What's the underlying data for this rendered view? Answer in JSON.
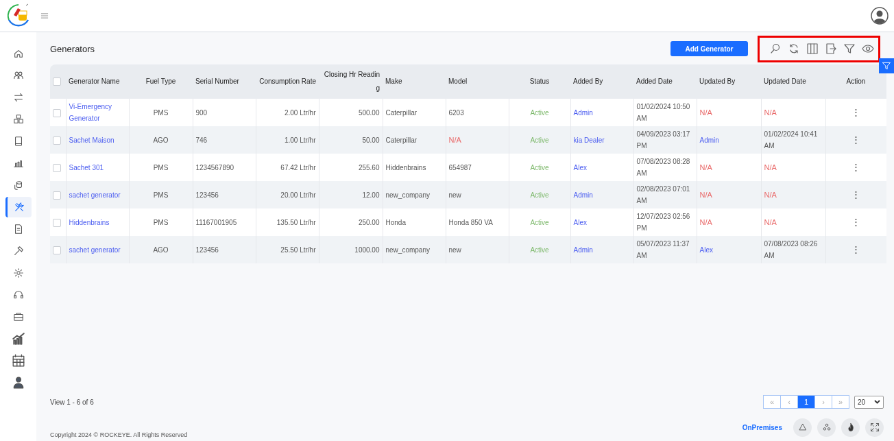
{
  "sidebar": {
    "items": [
      {
        "selected": false
      },
      {
        "selected": false
      },
      {
        "selected": false
      },
      {
        "selected": false
      },
      {
        "selected": false
      },
      {
        "selected": false
      },
      {
        "selected": false
      },
      {
        "selected": true
      },
      {
        "selected": false
      },
      {
        "selected": false
      },
      {
        "selected": false
      },
      {
        "selected": false
      },
      {
        "selected": false
      },
      {
        "selected": false
      },
      {
        "selected": false
      },
      {
        "selected": false
      }
    ]
  },
  "page": {
    "title": "Generators",
    "add_button": "Add Generator"
  },
  "toolbar": {
    "highlighted": true
  },
  "table": {
    "select_all_checked": false,
    "columns": [
      "Generator Name",
      "Fuel Type",
      "Serial Number",
      "Consumption Rate",
      "Closing Hr Reading",
      "Make",
      "Model",
      "Status",
      "Added By",
      "Added Date",
      "Updated By",
      "Updated Date",
      "Action"
    ],
    "rows": [
      {
        "checked": false,
        "name": "Vi-Emergency Generator",
        "fuel_type": "PMS",
        "serial": "900",
        "rate": "2.00 Ltr/hr",
        "closing": "500.00",
        "make": "Caterpillar",
        "model": {
          "text": "6203",
          "kind": "plain"
        },
        "status": "Active",
        "added_by": "Admin",
        "added_date": "01/02/2024 10:50 AM",
        "updated_by": {
          "text": "N/A",
          "kind": "missing"
        },
        "updated_date": {
          "text": "N/A",
          "kind": "missing"
        },
        "action": "⋮"
      },
      {
        "checked": false,
        "name": "Sachet Maison",
        "fuel_type": "AGO",
        "serial": "746",
        "rate": "1.00 Ltr/hr",
        "closing": "50.00",
        "make": "Caterpillar",
        "model": {
          "text": "N/A",
          "kind": "missing"
        },
        "status": "Active",
        "added_by": "kia Dealer",
        "added_date": "04/09/2023 03:17 PM",
        "updated_by": {
          "text": "Admin",
          "kind": "link"
        },
        "updated_date": {
          "text": "01/02/2024 10:41 AM",
          "kind": "plain"
        },
        "action": "⋮"
      },
      {
        "checked": false,
        "name": "Sachet 301",
        "fuel_type": "PMS",
        "serial": "1234567890",
        "rate": "67.42 Ltr/hr",
        "closing": "255.60",
        "make": "Hiddenbrains",
        "model": {
          "text": "654987",
          "kind": "plain"
        },
        "status": "Active",
        "added_by": "Alex",
        "added_date": "07/08/2023 08:28 AM",
        "updated_by": {
          "text": "N/A",
          "kind": "missing"
        },
        "updated_date": {
          "text": "N/A",
          "kind": "missing"
        },
        "action": "⋮"
      },
      {
        "checked": false,
        "name": "sachet generator",
        "fuel_type": "PMS",
        "serial": "123456",
        "rate": "20.00 Ltr/hr",
        "closing": "12.00",
        "make": "new_company",
        "model": {
          "text": "new",
          "kind": "plain"
        },
        "status": "Active",
        "added_by": "Admin",
        "added_date": "02/08/2023 07:01 AM",
        "updated_by": {
          "text": "N/A",
          "kind": "missing"
        },
        "updated_date": {
          "text": "N/A",
          "kind": "missing"
        },
        "action": "⋮"
      },
      {
        "checked": false,
        "name": "Hiddenbrains",
        "fuel_type": "PMS",
        "serial": "11167001905",
        "rate": "135.50 Ltr/hr",
        "closing": "250.00",
        "make": "Honda",
        "model": {
          "text": "Honda 850 VA",
          "kind": "plain"
        },
        "status": "Active",
        "added_by": "Alex",
        "added_date": "12/07/2023 02:56 PM",
        "updated_by": {
          "text": "N/A",
          "kind": "missing"
        },
        "updated_date": {
          "text": "N/A",
          "kind": "missing"
        },
        "action": "⋮"
      },
      {
        "checked": false,
        "name": "sachet generator",
        "fuel_type": "AGO",
        "serial": "123456",
        "rate": "25.50 Ltr/hr",
        "closing": "1000.00",
        "make": "new_company",
        "model": {
          "text": "new",
          "kind": "plain"
        },
        "status": "Active",
        "added_by": "Admin",
        "added_date": "05/07/2023 11:37 AM",
        "updated_by": {
          "text": "Alex",
          "kind": "link"
        },
        "updated_date": {
          "text": "07/08/2023 08:26 AM",
          "kind": "plain"
        },
        "action": "⋮"
      }
    ]
  },
  "pagination": {
    "summary": "View 1 - 6 of 6",
    "buttons": [
      {
        "label": "«",
        "selected": false
      },
      {
        "label": "‹",
        "selected": false
      },
      {
        "label": "1",
        "selected": true
      },
      {
        "label": "›",
        "selected": false
      },
      {
        "label": "»",
        "selected": false
      }
    ],
    "page_size": "20"
  },
  "footer": {
    "copyright": "Copyright 2024 © ROCKEYE. All Rights Reserved",
    "mode": "OnPremises"
  }
}
